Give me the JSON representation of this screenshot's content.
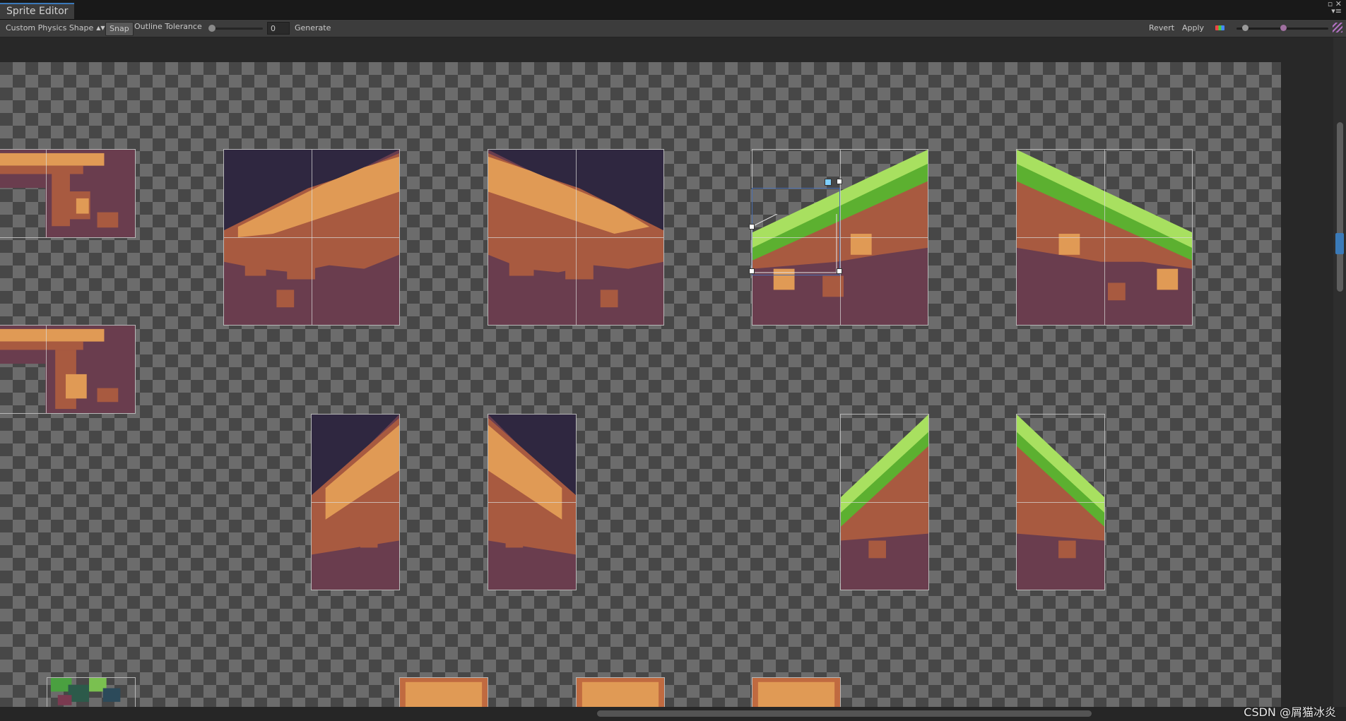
{
  "window": {
    "tab_title": "Sprite Editor",
    "controls": [
      "▫ ✕",
      "▾≡"
    ]
  },
  "toolbar": {
    "mode_label": "Custom Physics Shape",
    "mode_arrows": "▲▼",
    "snap_label": "Snap",
    "outline_tolerance_label": "Outline Tolerance",
    "outline_tolerance_value": "0",
    "outline_tolerance_fraction": 0,
    "generate_label": "Generate",
    "revert_label": "Revert",
    "apply_label": "Apply"
  },
  "icons": {
    "color_channel": "rgb-channel-icon",
    "resize": "resize-grip-icon"
  },
  "colors": {
    "tab_accent": "#3a79bb",
    "selection": "#4a6fb0",
    "handle_selected": "#7fd0ff",
    "sky": "#2f2740",
    "dirt_dark": "#6a3d4e",
    "dirt_mid": "#a85a40",
    "dirt_light": "#e09a55",
    "grass_light": "#a8e060",
    "grass_dark": "#5cb030"
  },
  "sprites": [
    {
      "name": "sprite-dirt-corner-top-left",
      "kind": "dirt-edge"
    },
    {
      "name": "sprite-dirt-corner-bottom-left",
      "kind": "dirt-edge"
    },
    {
      "name": "sprite-slope-up-2x2",
      "kind": "dirt-slope-up"
    },
    {
      "name": "sprite-slope-down-2x2",
      "kind": "dirt-slope-down"
    },
    {
      "name": "sprite-grass-slope-up-2x2",
      "kind": "grass-slope-up"
    },
    {
      "name": "sprite-grass-slope-down-2x2",
      "kind": "grass-slope-down"
    },
    {
      "name": "sprite-slope-up-1x2",
      "kind": "dirt-steep-up"
    },
    {
      "name": "sprite-slope-down-1x2",
      "kind": "dirt-steep-down"
    },
    {
      "name": "sprite-grass-slope-up-1x2",
      "kind": "grass-steep-up"
    },
    {
      "name": "sprite-grass-slope-down-1x2",
      "kind": "grass-steep-down"
    },
    {
      "name": "sprite-foliage",
      "kind": "foliage"
    },
    {
      "name": "sprite-platform-1",
      "kind": "platform"
    },
    {
      "name": "sprite-platform-2",
      "kind": "platform"
    },
    {
      "name": "sprite-platform-3",
      "kind": "platform"
    }
  ],
  "watermark": "CSDN @屑猫冰炎"
}
